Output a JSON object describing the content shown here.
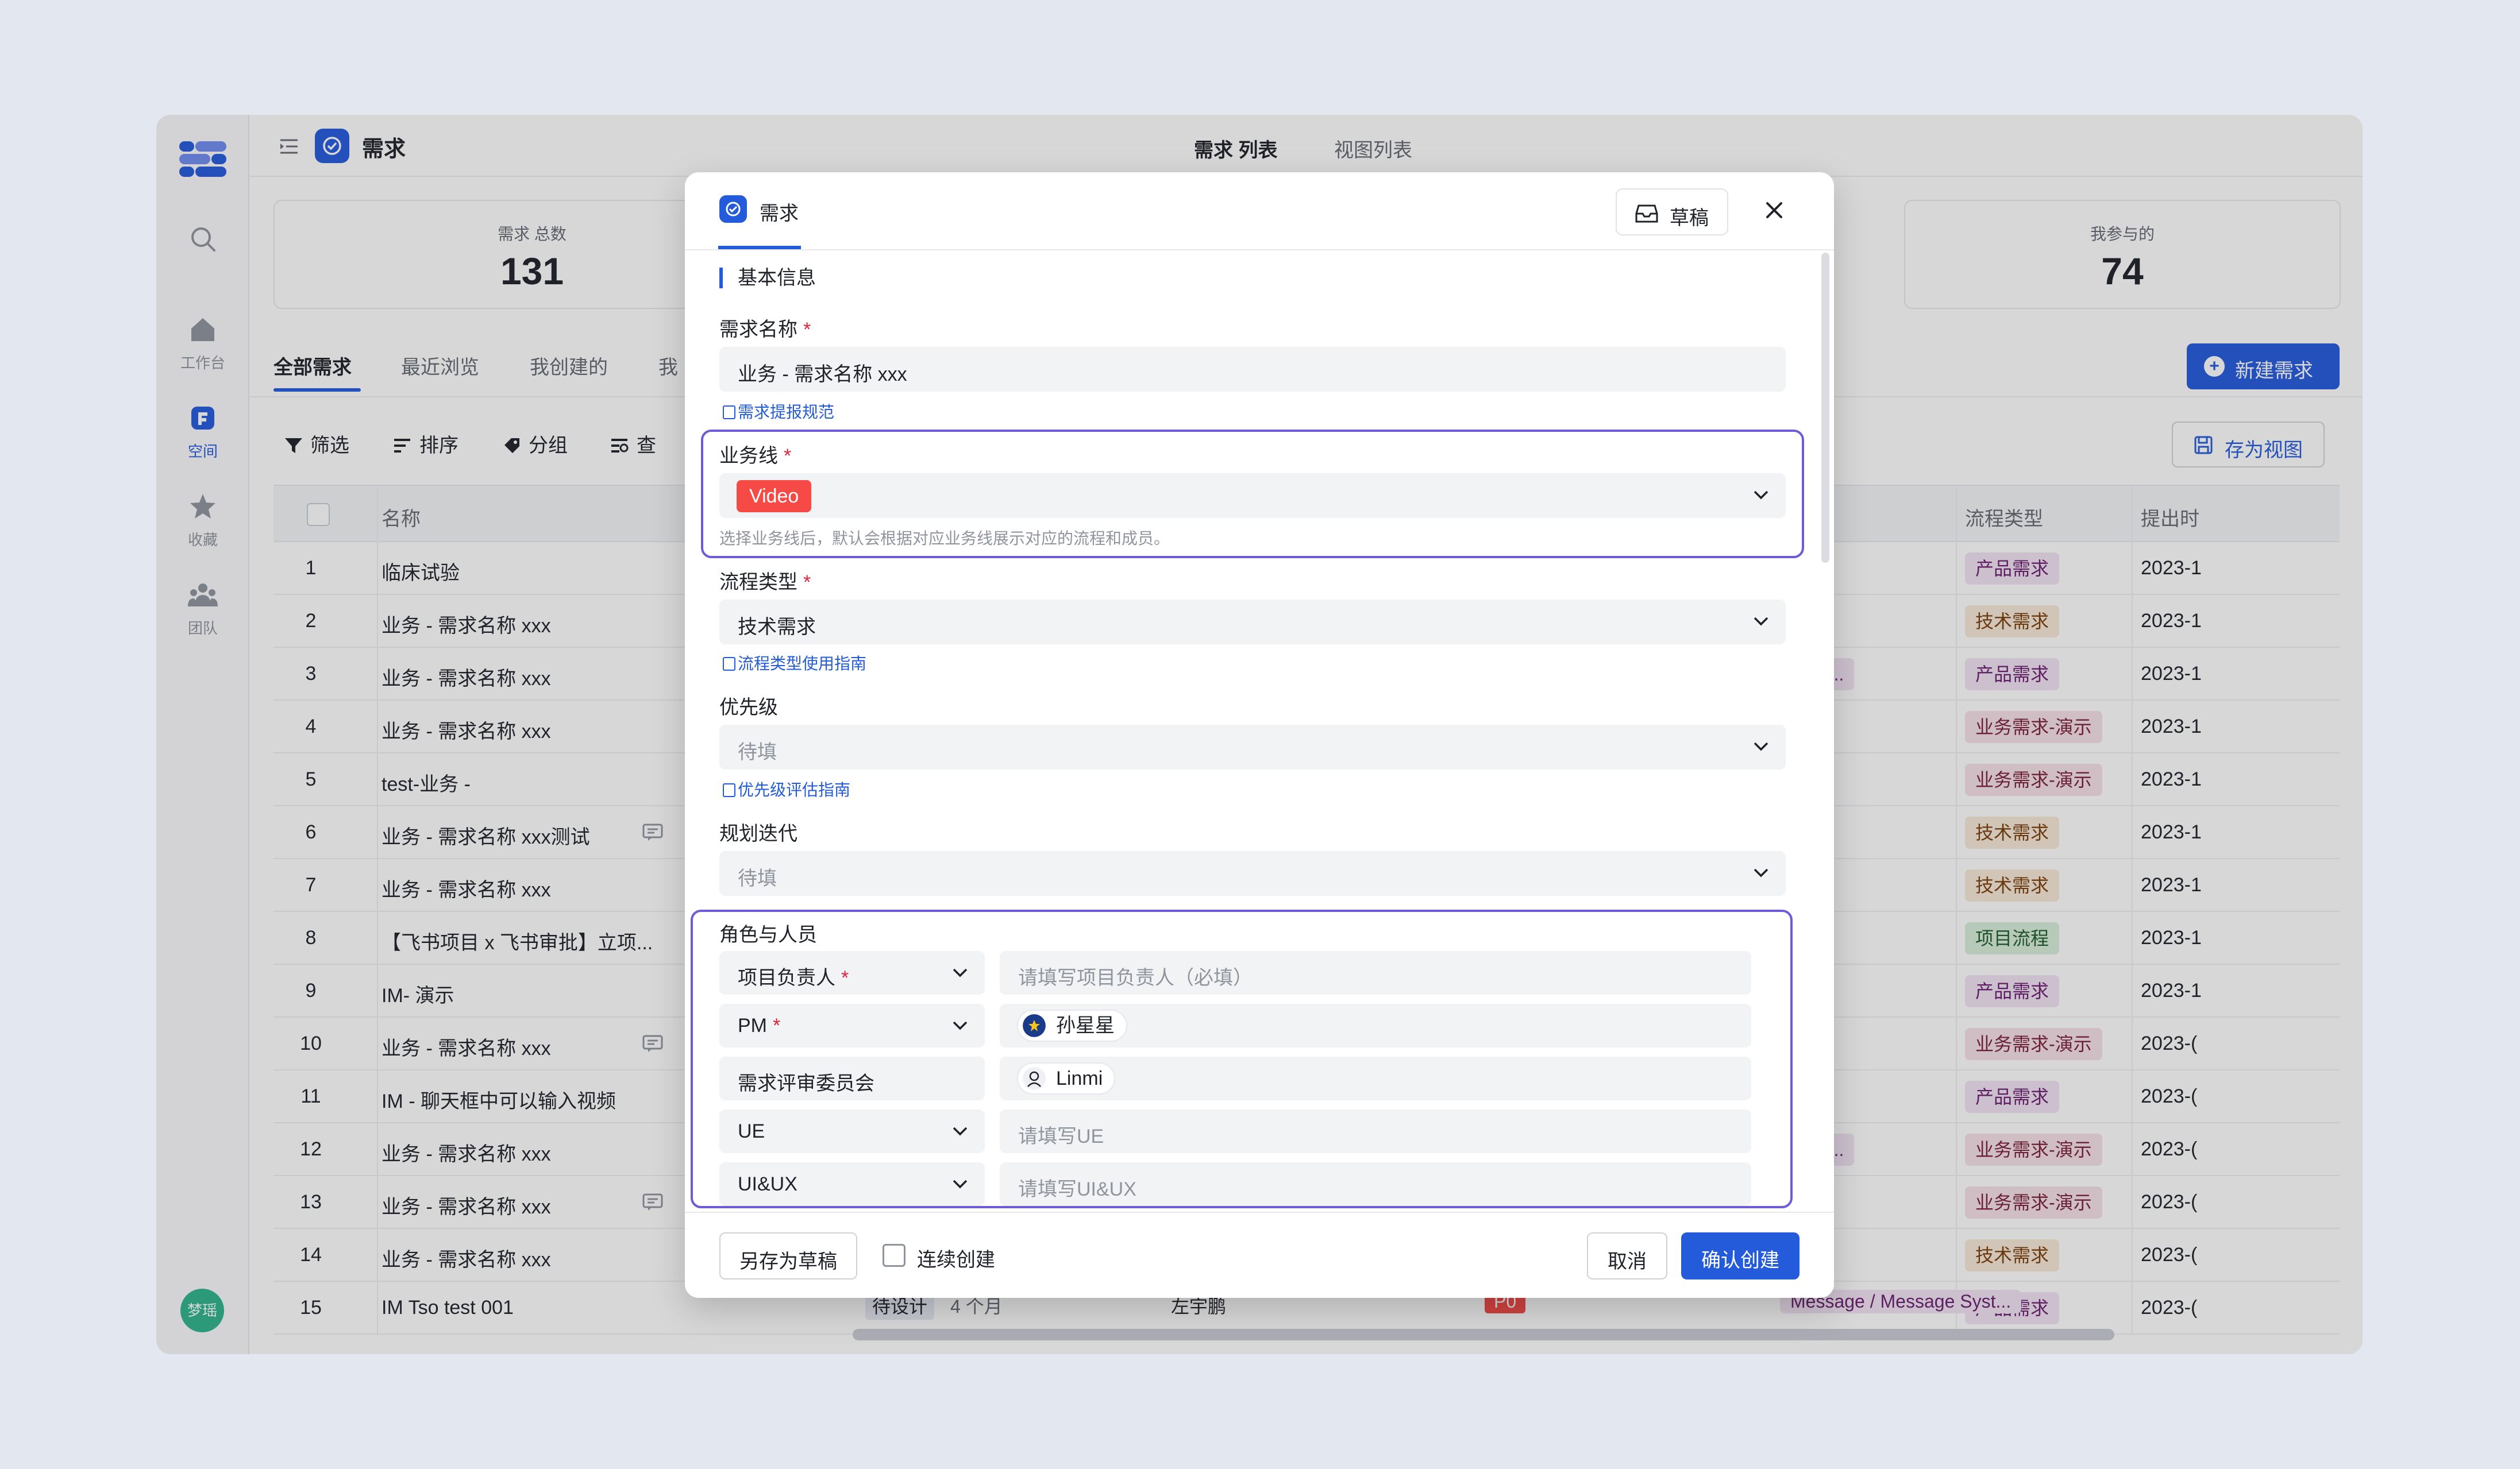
{
  "app": {
    "title": "需求",
    "tab_list": "需求 列表",
    "tab_views": "视图列表"
  },
  "sidebar": {
    "workbench": "工作台",
    "space": "空间",
    "favorites": "收藏",
    "team": "团队",
    "user_avatar": "梦瑶"
  },
  "stats": {
    "total_label": "需求 总数",
    "total_value": "131",
    "participated_label": "我参与的",
    "participated_value": "74"
  },
  "filter_tabs": [
    "全部需求",
    "最近浏览",
    "我创建的",
    "我"
  ],
  "new_button": "新建需求",
  "toolbar": {
    "filter": "筛选",
    "sort": "排序",
    "group": "分组",
    "search": "查",
    "save_view": "存为视图"
  },
  "table": {
    "col_name": "名称",
    "col_flow": "流程类型",
    "col_date": "提出时",
    "rows": [
      {
        "idx": "1",
        "name": "临床试验",
        "flow": "产品需求",
        "flow_kind": "prod",
        "date": "2023-1",
        "comment": false,
        "msg": ""
      },
      {
        "idx": "2",
        "name": "业务 - 需求名称 xxx",
        "flow": "技术需求",
        "flow_kind": "tech",
        "date": "2023-1",
        "comment": false,
        "msg": ""
      },
      {
        "idx": "3",
        "name": "业务 - 需求名称 xxx",
        "flow": "产品需求",
        "flow_kind": "prod",
        "date": "2023-1",
        "comment": false,
        "msg": "ge Syst..."
      },
      {
        "idx": "4",
        "name": "业务 - 需求名称 xxx",
        "flow": "业务需求-演示",
        "flow_kind": "biz",
        "date": "2023-1",
        "comment": false,
        "msg": ""
      },
      {
        "idx": "5",
        "name": "test-业务 -",
        "flow": "业务需求-演示",
        "flow_kind": "biz",
        "date": "2023-1",
        "comment": false,
        "msg": ""
      },
      {
        "idx": "6",
        "name": "业务 - 需求名称 xxx测试",
        "flow": "技术需求",
        "flow_kind": "tech",
        "date": "2023-1",
        "comment": true,
        "msg": ""
      },
      {
        "idx": "7",
        "name": "业务 - 需求名称 xxx",
        "flow": "技术需求",
        "flow_kind": "tech",
        "date": "2023-1",
        "comment": false,
        "msg": ""
      },
      {
        "idx": "8",
        "name": "【飞书项目 x 飞书审批】立项...",
        "flow": "项目流程",
        "flow_kind": "proj",
        "date": "2023-1",
        "comment": false,
        "msg": ""
      },
      {
        "idx": "9",
        "name": "IM- 演示",
        "flow": "产品需求",
        "flow_kind": "prod",
        "date": "2023-1",
        "comment": false,
        "msg": ""
      },
      {
        "idx": "10",
        "name": "业务 - 需求名称 xxx",
        "flow": "业务需求-演示",
        "flow_kind": "biz",
        "date": "2023-(",
        "comment": true,
        "msg": ""
      },
      {
        "idx": "11",
        "name": "IM - 聊天框中可以输入视频",
        "flow": "产品需求",
        "flow_kind": "prod",
        "date": "2023-(",
        "comment": false,
        "msg": ""
      },
      {
        "idx": "12",
        "name": "业务 - 需求名称 xxx",
        "flow": "业务需求-演示",
        "flow_kind": "biz",
        "date": "2023-(",
        "comment": false,
        "msg": "ge Syst..."
      },
      {
        "idx": "13",
        "name": "业务 - 需求名称 xxx",
        "flow": "业务需求-演示",
        "flow_kind": "biz",
        "date": "2023-(",
        "comment": true,
        "msg": ""
      },
      {
        "idx": "14",
        "name": "业务 - 需求名称 xxx",
        "flow": "技术需求",
        "flow_kind": "tech",
        "date": "2023-(",
        "comment": false,
        "msg": ""
      },
      {
        "idx": "15",
        "name": "IM Tso test 001",
        "flow": "产品需求",
        "flow_kind": "prod",
        "date": "2023-(",
        "comment": false,
        "msg": ""
      }
    ],
    "row15": {
      "status": "待设计",
      "duration": "4 个月",
      "owner": "左宇鹏",
      "priority": "P0",
      "message": "Message / Message Syst..."
    }
  },
  "modal": {
    "tab_title": "需求",
    "draft_button": "草稿",
    "section_basic": "基本信息",
    "name_label": "需求名称",
    "name_value": "业务 - 需求名称 xxx",
    "name_link": "需求提报规范",
    "biz_label": "业务线",
    "biz_value": "Video",
    "biz_hint": "选择业务线后，默认会根据对应业务线展示对应的流程和成员。",
    "flow_label": "流程类型",
    "flow_value": "技术需求",
    "flow_link": "流程类型使用指南",
    "priority_label": "优先级",
    "priority_placeholder": "待填",
    "priority_link": "优先级评估指南",
    "iteration_label": "规划迭代",
    "iteration_placeholder": "待填",
    "roles_label": "角色与人员",
    "roles": [
      {
        "role": "项目负责人",
        "required": true,
        "dropdown": true,
        "placeholder": "请填写项目负责人（必填）",
        "person": ""
      },
      {
        "role": "PM",
        "required": true,
        "dropdown": true,
        "placeholder": "",
        "person": "孙星星"
      },
      {
        "role": "需求评审委员会",
        "required": false,
        "dropdown": false,
        "placeholder": "",
        "person": "Linmi"
      },
      {
        "role": "UE",
        "required": false,
        "dropdown": true,
        "placeholder": "请填写UE",
        "person": ""
      },
      {
        "role": "UI&UX",
        "required": false,
        "dropdown": true,
        "placeholder": "请填写UI&UX",
        "person": ""
      }
    ],
    "save_draft": "另存为草稿",
    "continue_create": "连续创建",
    "cancel": "取消",
    "confirm": "确认创建"
  },
  "colors": {
    "accent": "#245bdb",
    "highlight": "#6f5bd8",
    "video_tag": "#f54a45",
    "required": "#e0243a"
  }
}
